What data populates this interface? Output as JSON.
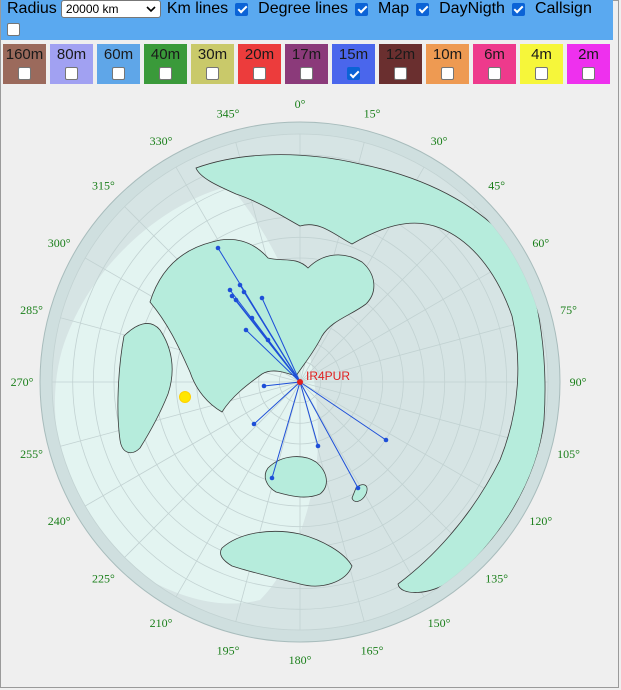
{
  "toolbar": {
    "radius_label": "Radius",
    "radius_value": "20000 km",
    "options": [
      {
        "label": "Km lines",
        "checked": true
      },
      {
        "label": "Degree lines",
        "checked": true
      },
      {
        "label": "Map",
        "checked": true
      },
      {
        "label": "DayNigth",
        "checked": true
      },
      {
        "label": "Callsign",
        "checked": false
      }
    ]
  },
  "bands": [
    {
      "label": "160m",
      "color": "#9b6a5c",
      "checked": false
    },
    {
      "label": "80m",
      "color": "#a1a1f2",
      "checked": false
    },
    {
      "label": "60m",
      "color": "#5fa6e8",
      "checked": false
    },
    {
      "label": "40m",
      "color": "#3a9a3a",
      "checked": false
    },
    {
      "label": "30m",
      "color": "#c9c96a",
      "checked": false
    },
    {
      "label": "20m",
      "color": "#ec3c3c",
      "checked": false
    },
    {
      "label": "17m",
      "color": "#8b3a7a",
      "checked": false
    },
    {
      "label": "15m",
      "color": "#4a66ec",
      "checked": true
    },
    {
      "label": "12m",
      "color": "#6a2f2f",
      "checked": false
    },
    {
      "label": "10m",
      "color": "#ee9a52",
      "checked": false
    },
    {
      "label": "6m",
      "color": "#ee3a8c",
      "checked": false
    },
    {
      "label": "4m",
      "color": "#f6f63a",
      "checked": false
    },
    {
      "label": "2m",
      "color": "#ee30ee",
      "checked": false
    }
  ],
  "map": {
    "callsign": "IR4PUR",
    "degree_labels": [
      "0°",
      "15°",
      "30°",
      "45°",
      "60°",
      "75°",
      "90°",
      "105°",
      "120°",
      "135°",
      "150°",
      "165°",
      "180°",
      "195°",
      "210°",
      "225°",
      "240°",
      "255°",
      "270°",
      "285°",
      "300°",
      "315°",
      "330°",
      "345°"
    ],
    "colors": {
      "spots": "#1e4fd8",
      "callsign": "#e02020",
      "degrees": "#1a7f1a",
      "land": "#b6ecdc"
    }
  }
}
